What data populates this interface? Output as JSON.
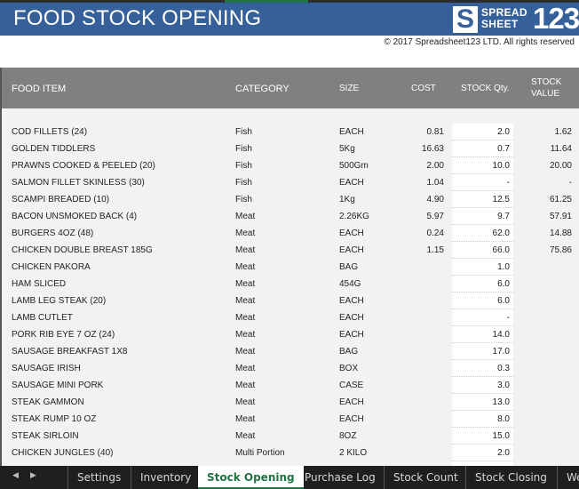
{
  "header": {
    "title": "FOOD STOCK OPENING",
    "logo": {
      "s": "S",
      "line1": "SPREAD",
      "line2": "SHEET",
      "number": "123"
    },
    "copyright": "© 2017 Spreadsheet123 LTD. All rights reserved"
  },
  "columns": {
    "item": "FOOD ITEM",
    "category": "CATEGORY",
    "size": "SIZE",
    "cost": "COST",
    "qty": "STOCK Qty.",
    "value_line1": "STOCK",
    "value_line2": "VALUE"
  },
  "rows": [
    {
      "item": "COD FILLETS (24)",
      "category": "Fish",
      "size": "EACH",
      "cost": "0.81",
      "qty": "2.0",
      "value": "1.62"
    },
    {
      "item": "GOLDEN TIDDLERS",
      "category": "Fish",
      "size": "5Kg",
      "cost": "16.63",
      "qty": "0.7",
      "value": "11.64"
    },
    {
      "item": "PRAWNS COOKED & PEELED (20)",
      "category": "Fish",
      "size": "500Gm",
      "cost": "2.00",
      "qty": "10.0",
      "value": "20.00"
    },
    {
      "item": "SALMON FILLET SKINLESS (30)",
      "category": "Fish",
      "size": "EACH",
      "cost": "1.04",
      "qty": "-",
      "value": "-"
    },
    {
      "item": "SCAMPI BREADED (10)",
      "category": "Fish",
      "size": "1Kg",
      "cost": "4.90",
      "qty": "12.5",
      "value": "61.25"
    },
    {
      "item": "BACON UNSMOKED BACK (4)",
      "category": "Meat",
      "size": "2.26KG",
      "cost": "5.97",
      "qty": "9.7",
      "value": "57.91"
    },
    {
      "item": "BURGERS 4OZ (48)",
      "category": "Meat",
      "size": "EACH",
      "cost": "0.24",
      "qty": "62.0",
      "value": "14.88"
    },
    {
      "item": "CHICKEN DOUBLE BREAST 185G",
      "category": "Meat",
      "size": "EACH",
      "cost": "1.15",
      "qty": "66.0",
      "value": "75.86"
    },
    {
      "item": "CHICKEN PAKORA",
      "category": "Meat",
      "size": "BAG",
      "cost": "",
      "qty": "1.0",
      "value": ""
    },
    {
      "item": "HAM SLICED",
      "category": "Meat",
      "size": "454G",
      "cost": "",
      "qty": "6.0",
      "value": ""
    },
    {
      "item": "LAMB LEG STEAK (20)",
      "category": "Meat",
      "size": "EACH",
      "cost": "",
      "qty": "6.0",
      "value": ""
    },
    {
      "item": "LAMB CUTLET",
      "category": "Meat",
      "size": "EACH",
      "cost": "",
      "qty": "-",
      "value": ""
    },
    {
      "item": "PORK RIB EYE 7 OZ (24)",
      "category": "Meat",
      "size": "EACH",
      "cost": "",
      "qty": "14.0",
      "value": ""
    },
    {
      "item": "SAUSAGE BREAKFAST 1X8",
      "category": "Meat",
      "size": "BAG",
      "cost": "",
      "qty": "17.0",
      "value": ""
    },
    {
      "item": "SAUSAGE IRISH",
      "category": "Meat",
      "size": "BOX",
      "cost": "",
      "qty": "0.3",
      "value": ""
    },
    {
      "item": "SAUSAGE MINI PORK",
      "category": "Meat",
      "size": "CASE",
      "cost": "",
      "qty": "3.0",
      "value": ""
    },
    {
      "item": "STEAK GAMMON",
      "category": "Meat",
      "size": "EACH",
      "cost": "",
      "qty": "13.0",
      "value": ""
    },
    {
      "item": "STEAK RUMP 10 OZ",
      "category": "Meat",
      "size": "EACH",
      "cost": "",
      "qty": "8.0",
      "value": ""
    },
    {
      "item": "STEAK SIRLOIN",
      "category": "Meat",
      "size": "8OZ",
      "cost": "",
      "qty": "15.0",
      "value": ""
    },
    {
      "item": "CHICKEN JUNGLES (40)",
      "category": "Multi Portion",
      "size": "2 KILO",
      "cost": "",
      "qty": "2.0",
      "value": ""
    }
  ],
  "sheet_tabs": {
    "prev": "◀",
    "next": "▶",
    "items": [
      "Settings",
      "Inventory",
      "Stock Opening",
      "Purchase Log",
      "Stock Count",
      "Stock Closing",
      "We"
    ],
    "active": "Stock Opening"
  }
}
